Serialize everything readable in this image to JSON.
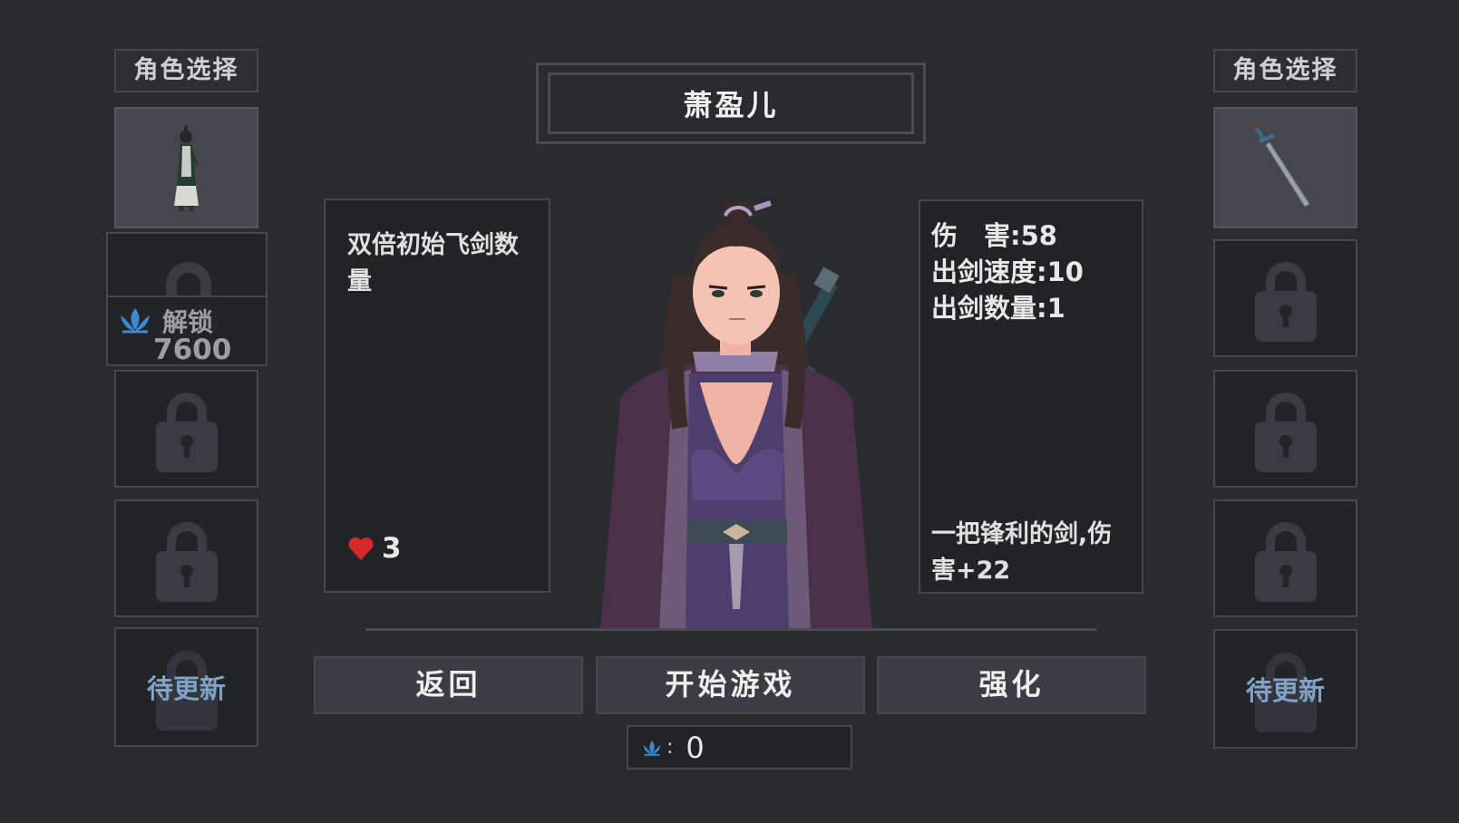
{
  "left_column": {
    "label": "角色选择",
    "unlock_label": "解锁",
    "unlock_cost": "7600",
    "update_label": "待更新"
  },
  "right_column": {
    "label": "角色选择",
    "update_label": "待更新"
  },
  "character": {
    "name": "萧盈儿",
    "skill": "双倍初始飞剑数量",
    "hearts": "3"
  },
  "weapon": {
    "damage_label": "伤　害:",
    "damage": "58",
    "speed_label": "出剑速度:",
    "speed": "10",
    "count_label": "出剑数量:",
    "count": "1",
    "description": "一把锋利的剑,伤害+22"
  },
  "buttons": {
    "back": "返回",
    "start": "开始游戏",
    "upgrade": "强化"
  },
  "currency": {
    "separator": ":",
    "amount": "0"
  },
  "icons": {
    "heart": "heart-icon",
    "lotus": "lotus-icon",
    "lock": "lock-icon",
    "sword": "sword-icon"
  },
  "colors": {
    "background": "#2a2b2f",
    "heart": "#d42a2a",
    "lotus": "#3f87d6",
    "update_text": "#7fa2c6"
  }
}
